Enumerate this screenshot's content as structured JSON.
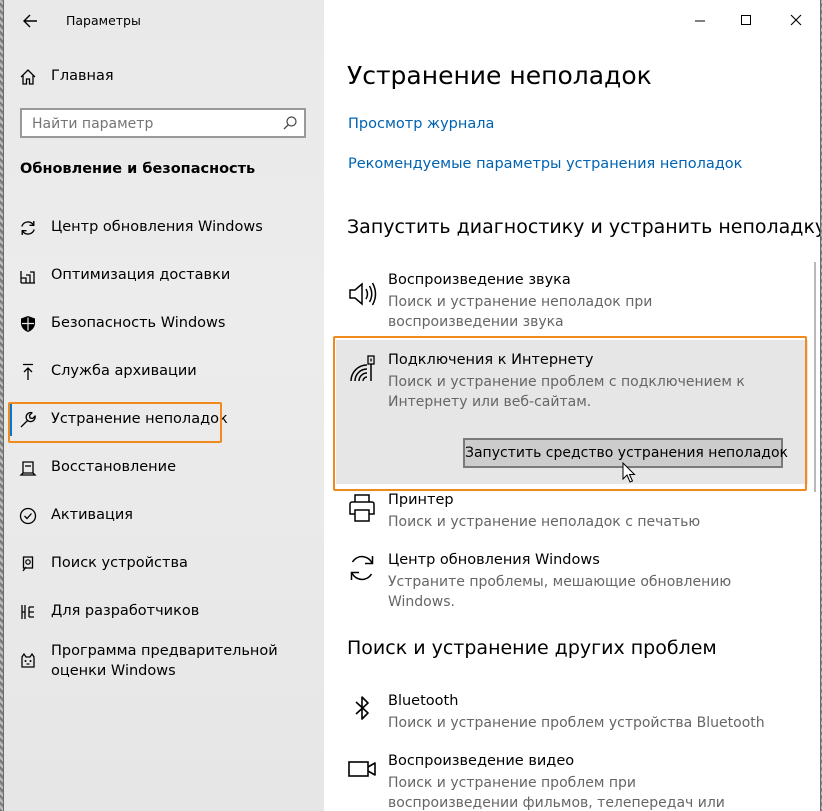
{
  "window": {
    "title": "Параметры"
  },
  "sidebar": {
    "home_label": "Главная",
    "search_placeholder": "Найти параметр",
    "section_title": "Обновление и безопасность",
    "items": [
      {
        "label": "Центр обновления Windows",
        "icon": "refresh-icon"
      },
      {
        "label": "Оптимизация доставки",
        "icon": "delivery-optimization-icon"
      },
      {
        "label": "Безопасность Windows",
        "icon": "shield-icon"
      },
      {
        "label": "Служба архивации",
        "icon": "backup-arrow-icon"
      },
      {
        "label": "Устранение неполадок",
        "icon": "wrench-icon",
        "selected": true
      },
      {
        "label": "Восстановление",
        "icon": "recovery-icon"
      },
      {
        "label": "Активация",
        "icon": "activation-check-icon"
      },
      {
        "label": "Поиск устройства",
        "icon": "find-device-icon"
      },
      {
        "label": "Для разработчиков",
        "icon": "developer-icon"
      },
      {
        "label": "Программа предварительной оценки Windows",
        "icon": "insider-cat-icon"
      }
    ]
  },
  "main": {
    "page_title": "Устранение неполадок",
    "links": [
      "Просмотр журнала",
      "Рекомендуемые параметры устранения неполадок"
    ],
    "section1_title": "Запустить диагностику и устранить неполадку",
    "section2_title": "Поиск и устранение других проблем",
    "run_button_label": "Запустить средство устранения неполадок",
    "troubleshooters": [
      {
        "title": "Воспроизведение звука",
        "desc": "Поиск и устранение неполадок при воспроизведении звука",
        "icon": "speaker-icon"
      },
      {
        "title": "Подключения к Интернету",
        "desc": "Поиск и устранение проблем с подключением к Интернету или веб-сайтам.",
        "icon": "internet-connection-icon",
        "expanded": true
      },
      {
        "title": "Принтер",
        "desc": "Поиск и устранение неполадок с печатью",
        "icon": "printer-icon"
      },
      {
        "title": "Центр обновления Windows",
        "desc": "Устраните проблемы, мешающие обновлению Windows.",
        "icon": "windows-update-icon"
      }
    ],
    "other_troubleshooters": [
      {
        "title": "Bluetooth",
        "desc": "Поиск и устранение проблем устройства Bluetooth",
        "icon": "bluetooth-icon"
      },
      {
        "title": "Воспроизведение видео",
        "desc": "Поиск и устранение проблем при воспроизведении фильмов, телепередач или видео",
        "icon": "video-camera-icon"
      }
    ]
  },
  "colors": {
    "accent": "#0078d7",
    "link": "#0063b1",
    "highlight_box": "#f08a1c"
  }
}
